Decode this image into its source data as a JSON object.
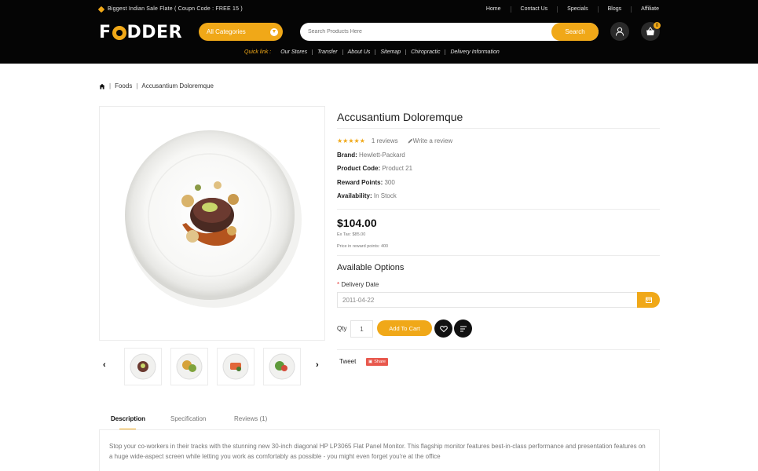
{
  "header": {
    "offer_text": "Biggest Indian Sale Flate ( Coupn Code : FREE 15 )",
    "toplinks": [
      "Home",
      "Contact Us",
      "Specials",
      "Blogs",
      "Affiliate"
    ],
    "logo_left": "F",
    "logo_right": "DDER",
    "category_label": "All Categories",
    "search_placeholder": "Search Products Here",
    "search_button": "Search",
    "cart_count": "0",
    "quicklink_label": "Quick link :",
    "quicklinks": [
      "Our Stores",
      "Transfer",
      "About Us",
      "Sitemap",
      "Chiropractic",
      "Delivery Information"
    ],
    "brand_color": "#f0a818"
  },
  "breadcrumb": {
    "items": [
      "Foods",
      "Accusantium Doloremque"
    ]
  },
  "product": {
    "title": "Accusantium Doloremque",
    "rating": 5,
    "reviews_text": "1 reviews",
    "write_review": "Write a review",
    "brand_label": "Brand:",
    "brand_value": "Hewlett-Packard",
    "code_label": "Product Code:",
    "code_value": "Product 21",
    "reward_label": "Reward Points:",
    "reward_value": "300",
    "availability_label": "Availability:",
    "availability_value": "In Stock",
    "price": "$104.00",
    "ex_tax": "Ex Tax: $85.00",
    "reward_price": "Price in reward points: 400",
    "options_title": "Available Options",
    "delivery_label": "Delivery Date",
    "delivery_value": "2011-04-22",
    "qty_label": "Qty",
    "qty_value": "1",
    "add_to_cart": "Add To Cart",
    "tweet": "Tweet",
    "share": "Share"
  },
  "tabs": [
    "Description",
    "Specification",
    "Reviews (1)"
  ],
  "description": "Stop your co-workers in their tracks with the stunning new 30-inch diagonal HP LP3065 Flat Panel Monitor. This flagship monitor features best-in-class performance and presentation features on a huge wide-aspect screen while letting you work as comfortably as possible - you might even forget you're at the office"
}
